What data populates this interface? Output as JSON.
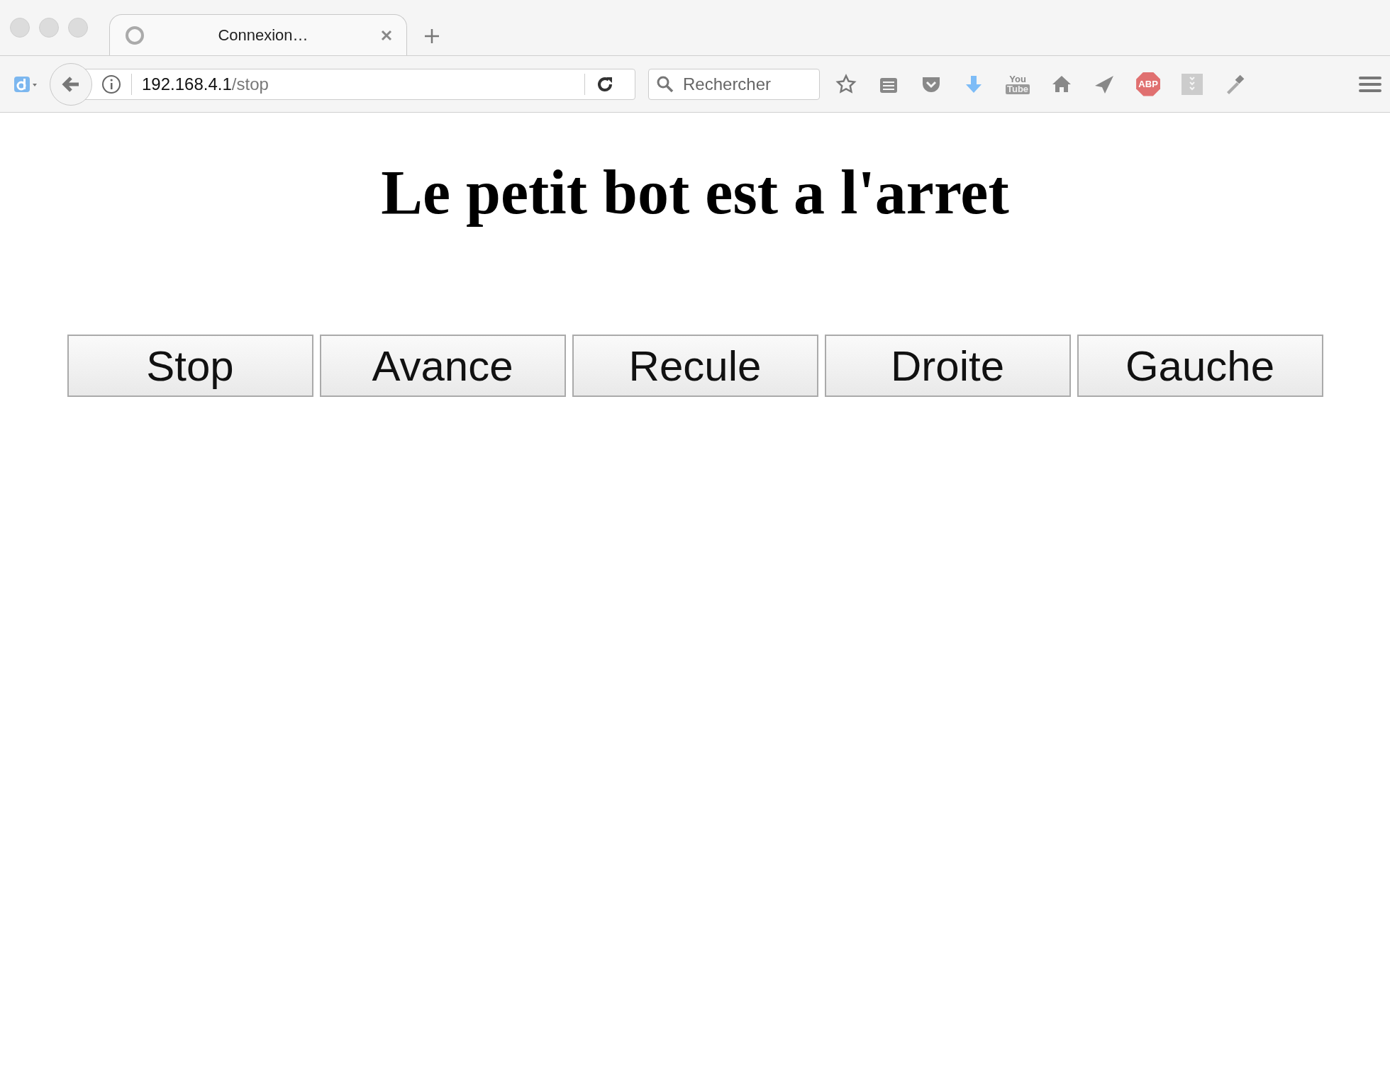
{
  "tabs": [
    {
      "title": "Connexion…",
      "selected": true,
      "loading": true
    }
  ],
  "address_bar": {
    "host": "192.168.4.1",
    "path": "/stop"
  },
  "search": {
    "placeholder": "Rechercher"
  },
  "toolbar": {
    "youtube_top": "You",
    "youtube_bottom": "Tube",
    "adblock": "ABP"
  },
  "page": {
    "heading": "Le petit bot est a l'arret",
    "buttons": [
      "Stop",
      "Avance",
      "Recule",
      "Droite",
      "Gauche"
    ]
  }
}
